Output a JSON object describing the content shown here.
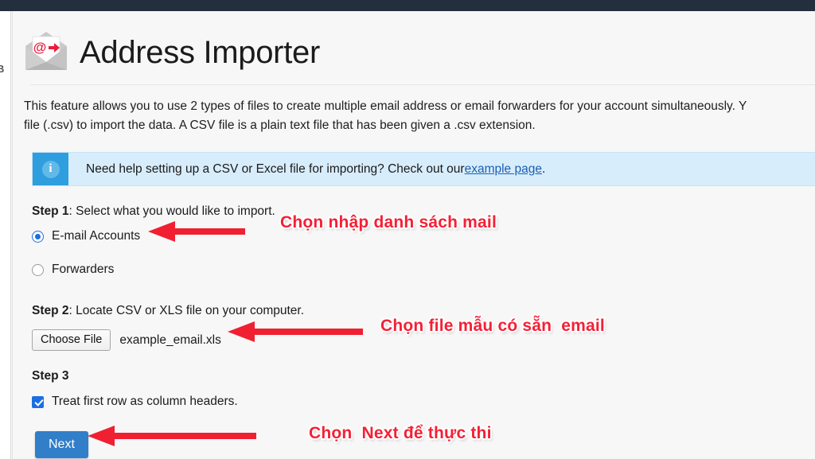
{
  "topbar": {
    "label": "dark-title-bar"
  },
  "sidebar": {
    "cut_glyph": "B"
  },
  "header": {
    "title": "Address Importer",
    "icon": "envelope-at-arrow-icon"
  },
  "description": {
    "line1": "This feature allows you to use 2 types of files to create multiple email address or email forwarders for your account simultaneously. Y",
    "line2": "file (.csv) to import the data. A CSV file is a plain text file that has been given a .csv extension."
  },
  "info_banner": {
    "icon": "info-icon",
    "icon_glyph": "i",
    "text_before": "Need help setting up a CSV or Excel file for importing? Check out our ",
    "link_text": "example page",
    "text_after": ".",
    "box_color": "#2e9ede",
    "background_color": "#d8edfb"
  },
  "step1": {
    "label_bold": "Step 1",
    "label_rest": ": Select what you would like to import.",
    "options": [
      {
        "label": "E-mail Accounts",
        "selected": true
      },
      {
        "label": "Forwarders",
        "selected": false
      }
    ]
  },
  "step2": {
    "label_bold": "Step 2",
    "label_rest": ": Locate CSV or XLS file on your computer.",
    "choose_file_button": "Choose File",
    "file_name": "example_email.xls"
  },
  "step3": {
    "label": "Step 3",
    "checkbox_label": "Treat first row as column headers.",
    "checkbox_checked": true
  },
  "actions": {
    "next_label": "Next",
    "next_color": "#317ec9"
  },
  "annotations": {
    "color": "#f42036",
    "items": [
      {
        "text": "Chọn nhập danh sách mail",
        "arrow": "left-arrow-icon"
      },
      {
        "text": "Chọn file mẫu có sẵn  email",
        "arrow": "left-arrow-icon"
      },
      {
        "text": "Chọn  Next để thực thi",
        "arrow": "left-arrow-icon"
      }
    ]
  }
}
